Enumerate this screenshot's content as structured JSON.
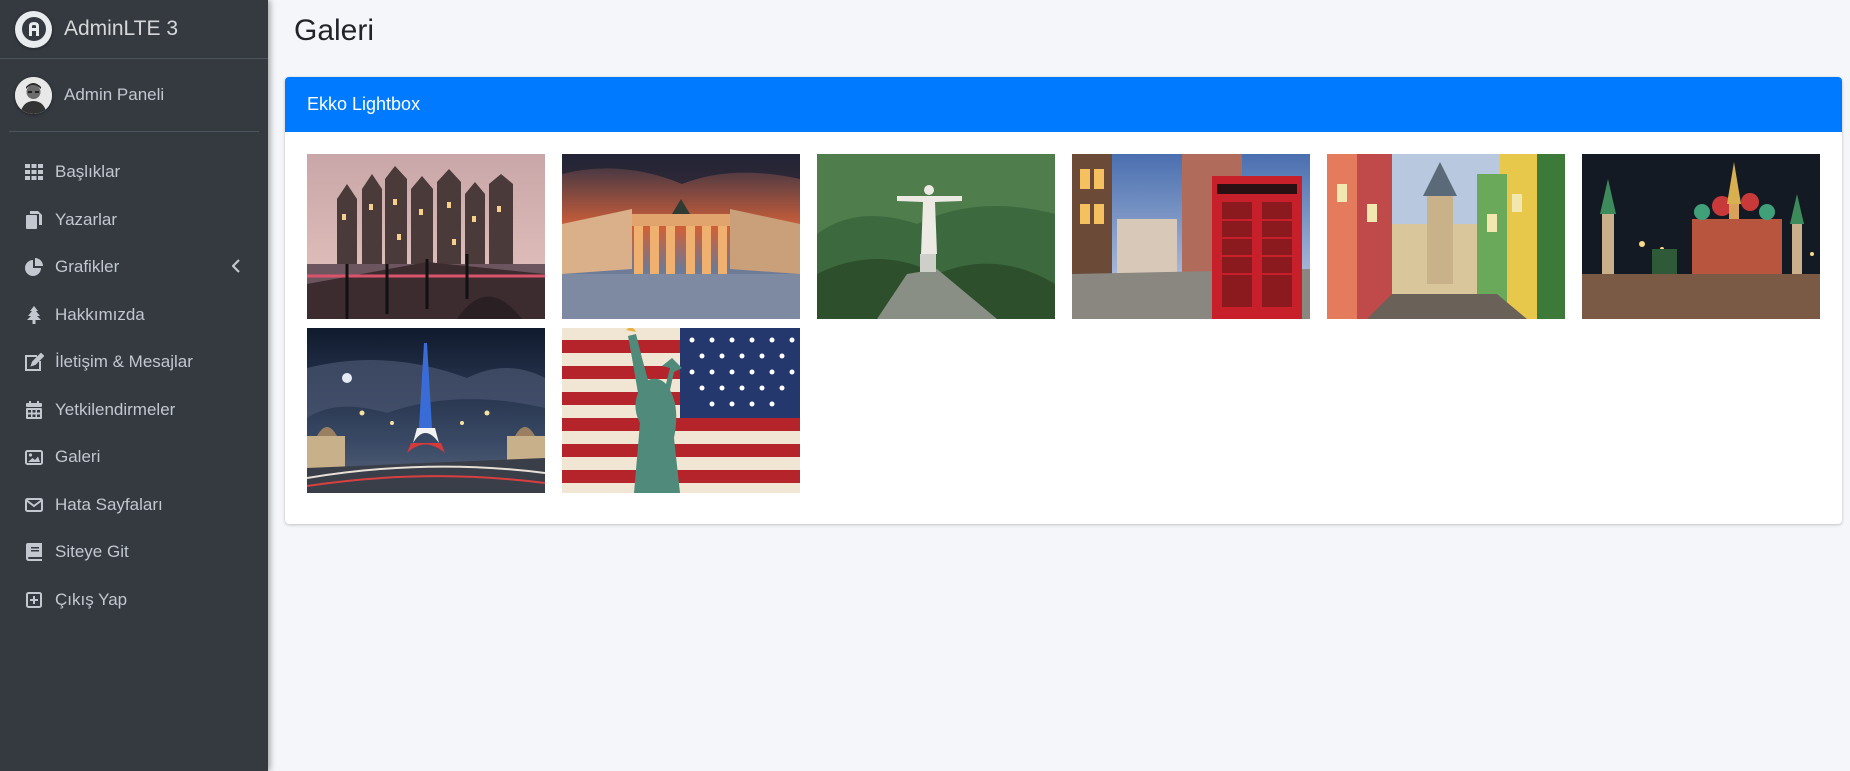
{
  "brand": {
    "name": "AdminLTE 3"
  },
  "user": {
    "name": "Admin Paneli"
  },
  "menu": [
    {
      "label": "Başlıklar",
      "icon": "th-icon"
    },
    {
      "label": "Yazarlar",
      "icon": "copy-icon"
    },
    {
      "label": "Grafikler",
      "icon": "chart-pie-icon"
    },
    {
      "label": "Hakkımızda",
      "icon": "tree-icon"
    },
    {
      "label": "İletişim & Mesajlar",
      "icon": "edit-icon"
    },
    {
      "label": "Yetkilendirmeler",
      "icon": "calendar-icon"
    },
    {
      "label": "Galeri",
      "icon": "image-icon"
    },
    {
      "label": "Hata Sayfaları",
      "icon": "envelope-icon"
    },
    {
      "label": "Siteye Git",
      "icon": "book-icon"
    },
    {
      "label": "Çıkış Yap",
      "icon": "plus-square-icon"
    }
  ],
  "page": {
    "title": "Galeri"
  },
  "card": {
    "title": "Ekko Lightbox"
  },
  "gallery": [
    {
      "subject": "amsterdam-canal"
    },
    {
      "subject": "brandenburg-gate"
    },
    {
      "subject": "christ-the-redeemer"
    },
    {
      "subject": "london-phone-booth"
    },
    {
      "subject": "galata-tower"
    },
    {
      "subject": "st-basils-cathedral"
    },
    {
      "subject": "eiffel-tower"
    },
    {
      "subject": "statue-of-liberty-flag"
    }
  ],
  "colors": {
    "sidebar": "#343a40",
    "accent": "#007bff",
    "background": "#f4f6f9"
  }
}
